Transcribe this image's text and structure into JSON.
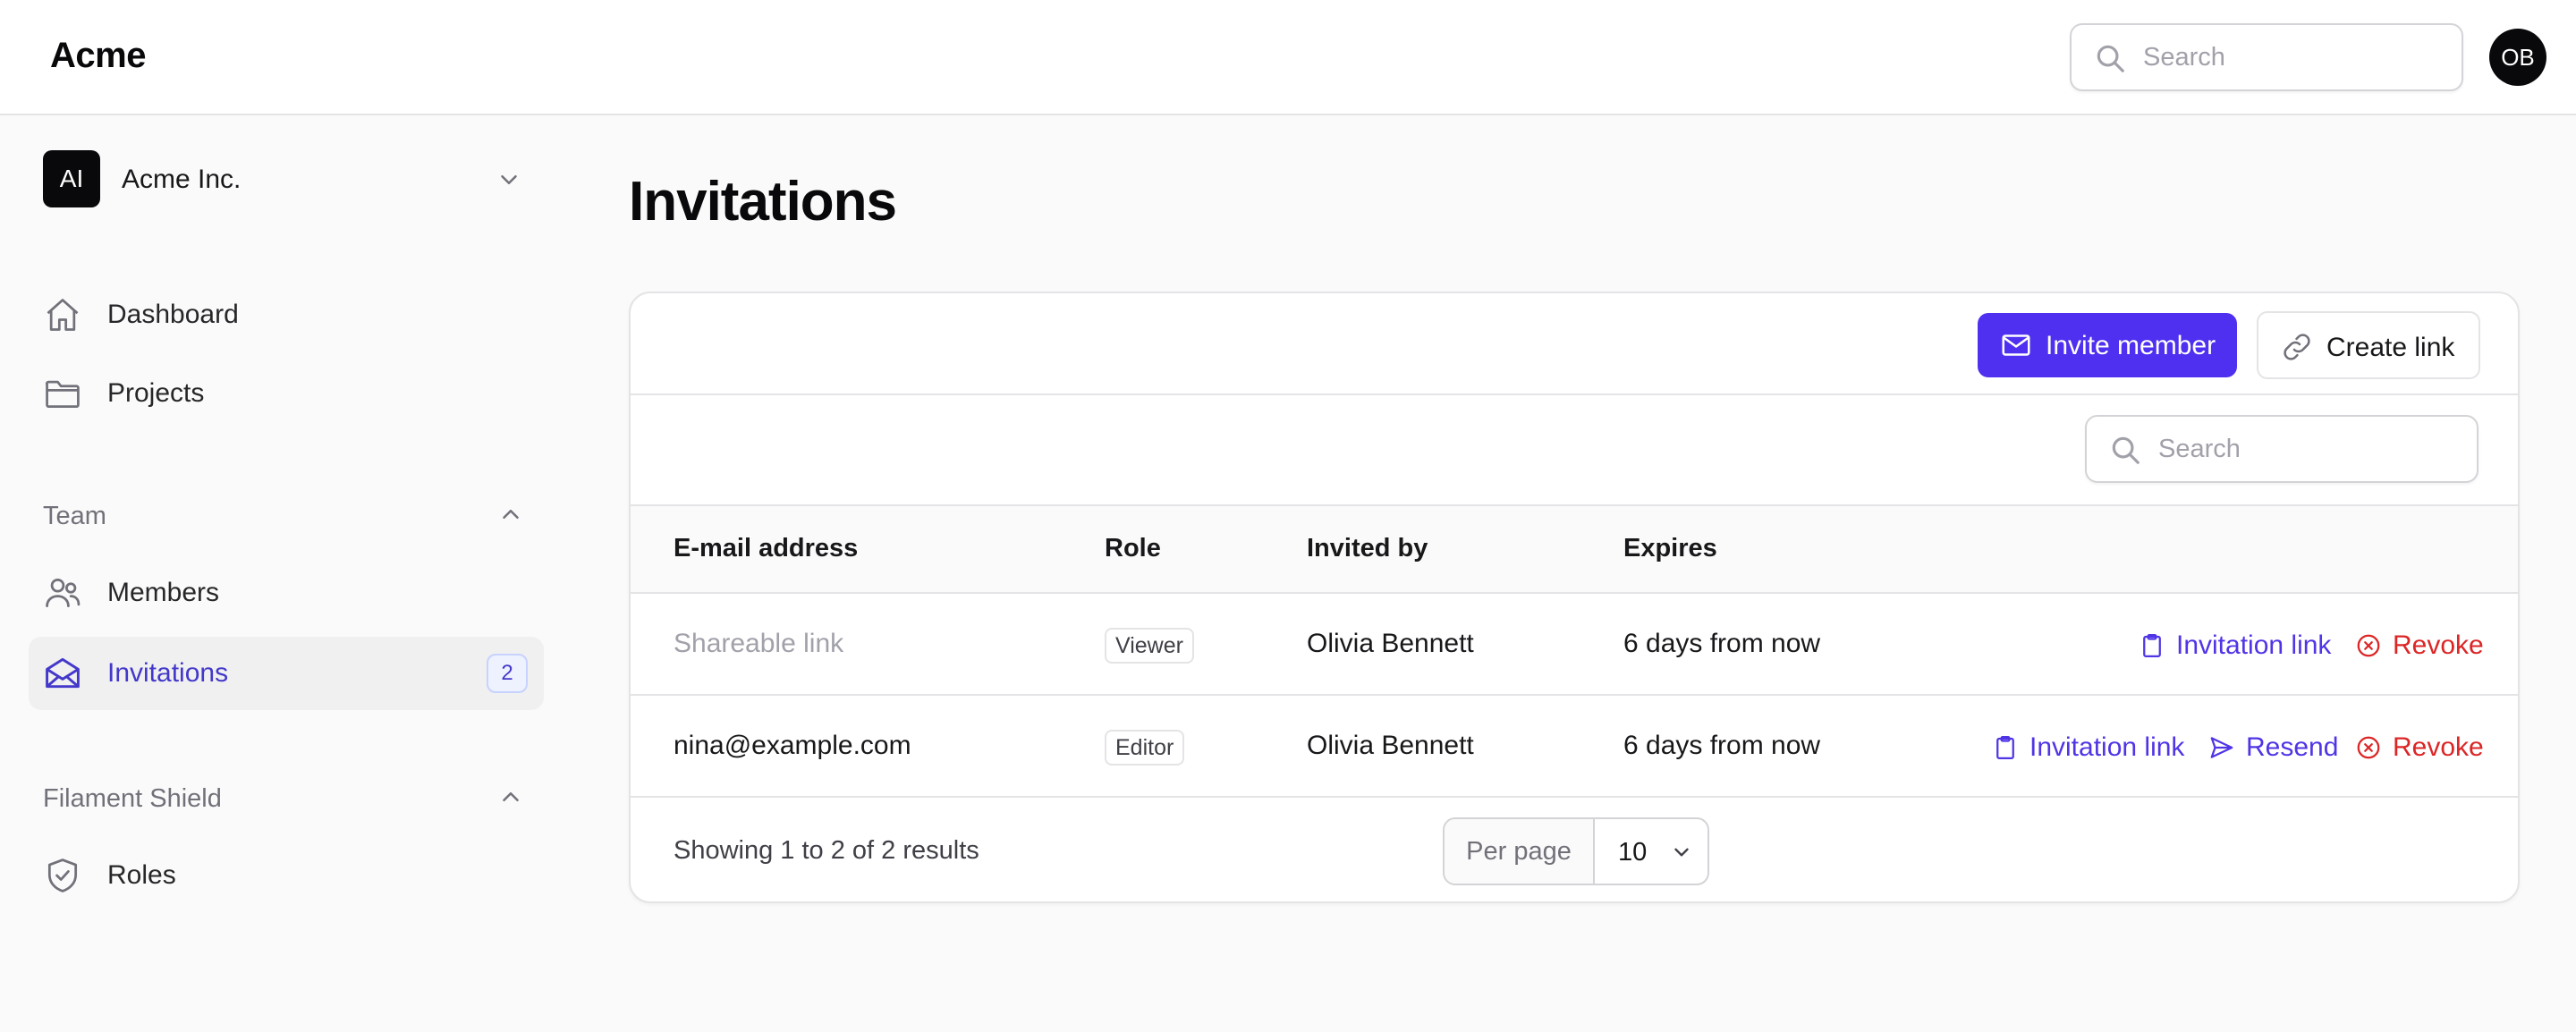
{
  "app": {
    "brand": "Acme"
  },
  "header": {
    "search_placeholder": "Search",
    "user_initials": "OB"
  },
  "sidebar": {
    "tenant": {
      "initials": "AI",
      "name": "Acme Inc."
    },
    "items": [
      {
        "label": "Dashboard",
        "icon": "home-icon"
      },
      {
        "label": "Projects",
        "icon": "folder-icon"
      }
    ],
    "groups": [
      {
        "title": "Team",
        "items": [
          {
            "label": "Members",
            "icon": "users-icon"
          },
          {
            "label": "Invitations",
            "icon": "envelope-open-icon",
            "badge": "2",
            "active": true
          }
        ]
      },
      {
        "title": "Filament Shield",
        "items": [
          {
            "label": "Roles",
            "icon": "shield-check-icon"
          }
        ]
      }
    ]
  },
  "page": {
    "title": "Invitations",
    "invite_button": "Invite member",
    "create_link_button": "Create link",
    "table_search_placeholder": "Search"
  },
  "table": {
    "columns": [
      "E-mail address",
      "Role",
      "Invited by",
      "Expires"
    ],
    "rows": [
      {
        "email": "Shareable link",
        "role": "Viewer",
        "invited_by": "Olivia Bennett",
        "expires": "6 days from now",
        "actions": [
          "Invitation link",
          "Revoke"
        ]
      },
      {
        "email": "nina@example.com",
        "role": "Editor",
        "invited_by": "Olivia Bennett",
        "expires": "6 days from now",
        "actions": [
          "Invitation link",
          "Resend",
          "Revoke"
        ]
      }
    ],
    "footer": {
      "summary": "Showing 1 to 2 of 2 results",
      "per_page_label": "Per page",
      "per_page_value": "10"
    }
  },
  "colors": {
    "primary": "#4f2ff0",
    "danger": "#dc2626",
    "active_nav": "#4338ca"
  }
}
